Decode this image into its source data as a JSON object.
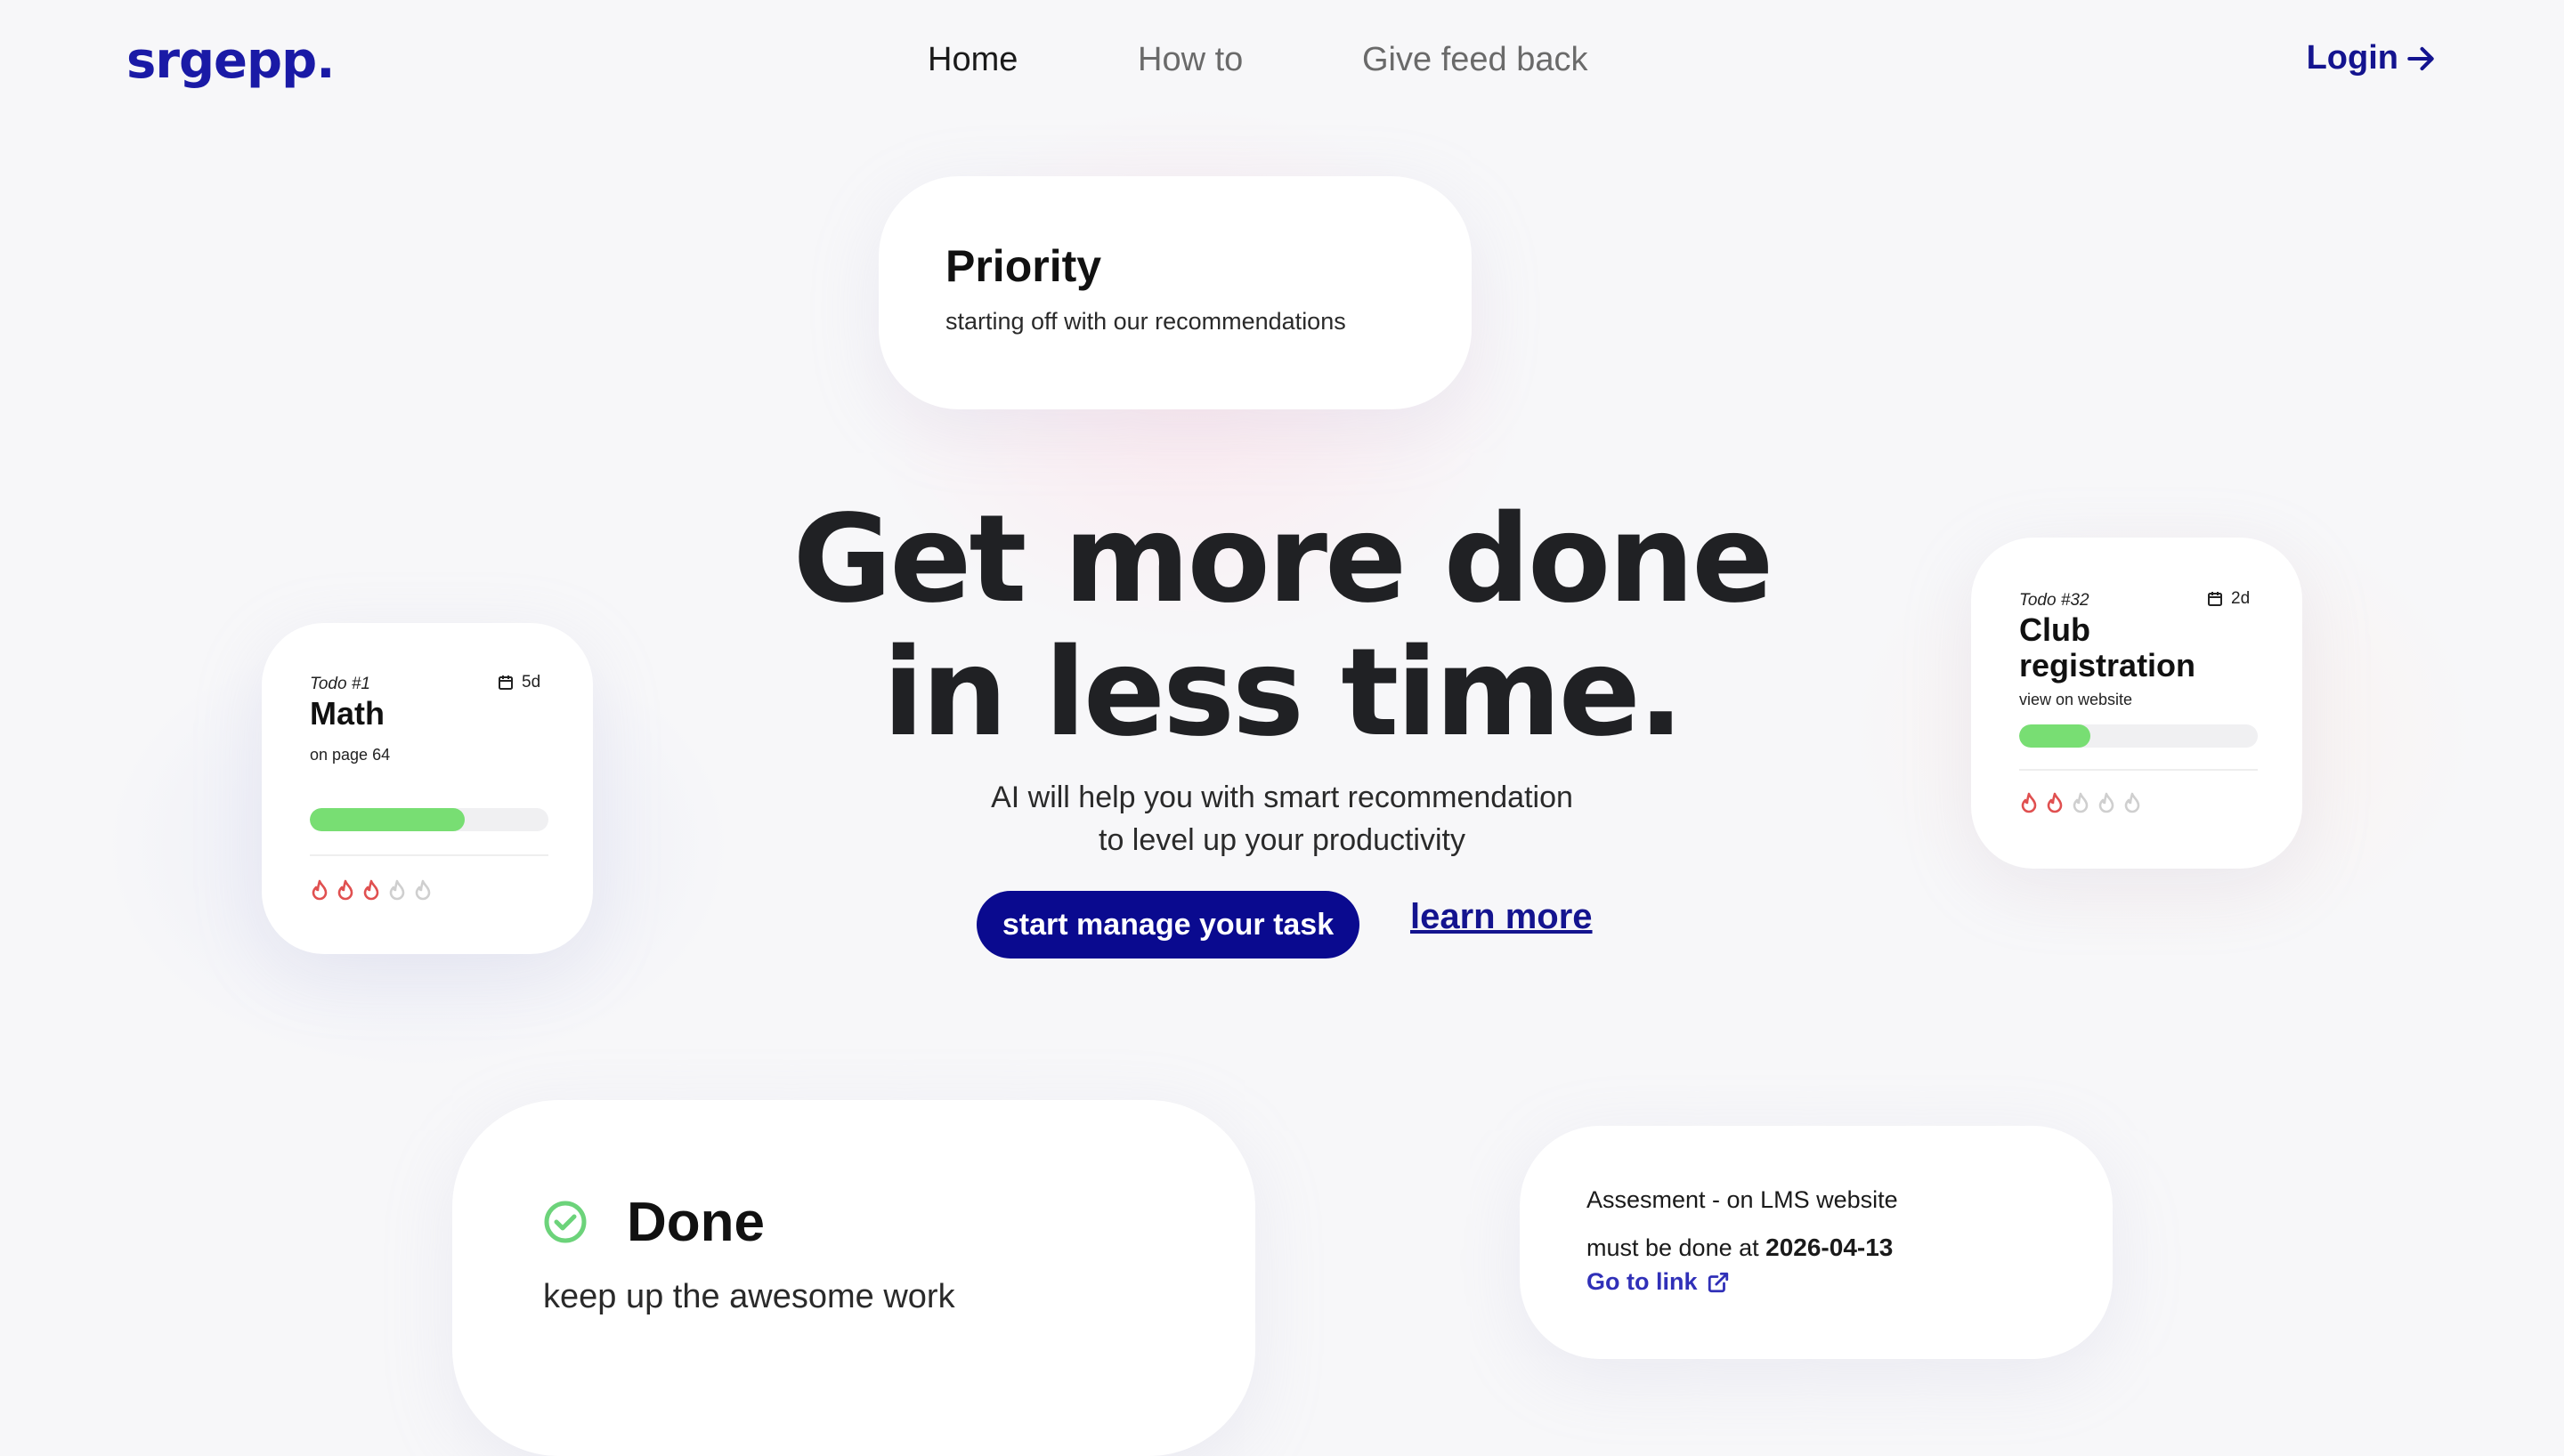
{
  "brand": {
    "logo": "srgepp."
  },
  "nav": {
    "items": [
      {
        "label": "Home"
      },
      {
        "label": "How to"
      },
      {
        "label": "Give feed back"
      }
    ],
    "login_label": "Login"
  },
  "priority_card": {
    "title": "Priority",
    "subtitle": "starting off with our recommendations"
  },
  "hero": {
    "line1": "Get more done",
    "line2": "in less time.",
    "desc_line1": "AI will help you with smart recommendation",
    "desc_line2": "to level up your productivity",
    "cta_label": "start manage your task",
    "learn_label": "learn more"
  },
  "todos": [
    {
      "number": "Todo #1",
      "due": "5d",
      "title": "Math",
      "note": "on page 64",
      "progress": 0.65,
      "priority": 3,
      "priority_max": 5
    },
    {
      "number": "Todo #32",
      "due": "2d",
      "title_line1": "Club",
      "title_line2": "registration",
      "note": "view on website",
      "progress": 0.3,
      "priority": 2,
      "priority_max": 5
    }
  ],
  "done_card": {
    "title": "Done",
    "subtitle": "keep up the awesome work"
  },
  "assessment_card": {
    "line1": "Assesment - on LMS website",
    "due_prefix": "must be done at ",
    "due_date": "2026-04-13",
    "link_label": "Go to link"
  },
  "colors": {
    "brand": "#14148f",
    "progress": "#78de73",
    "flame_active": "#e05050",
    "flame_inactive": "#cfcfcf",
    "check": "#6cd37a"
  },
  "icons": [
    "arrow-right-icon",
    "calendar-icon",
    "flame-icon",
    "check-circle-icon",
    "external-link-icon"
  ]
}
